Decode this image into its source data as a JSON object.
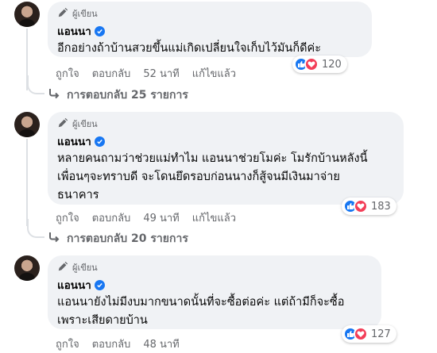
{
  "comments": [
    {
      "badge": "ผู้เขียน",
      "author": "แอนนา",
      "text": "อีกอย่างถ้าบ้านสวยขึ้นแม่เกิดเปลี่ยนใจเก็บไว้มันก็ดีค่ะ",
      "reaction_count": "120",
      "actions": {
        "like": "ถูกใจ",
        "reply": "ตอบกลับ",
        "time": "52 นาที",
        "edited": "แก้ไขแล้ว"
      },
      "replies": "การตอบกลับ 25 รายการ"
    },
    {
      "badge": "ผู้เขียน",
      "author": "แอนนา",
      "text": "หลายคนถามว่าช่วยแม่ทำไม แอนนาช่วยโมค่ะ โมรักบ้านหลังนี้\nเพื่อนๆจะทราบดี จะโดนยึดรอบก่อนนางก็สู้จนมีเงินมาจ่าย\nธนาคาร",
      "reaction_count": "183",
      "actions": {
        "like": "ถูกใจ",
        "reply": "ตอบกลับ",
        "time": "49 นาที",
        "edited": "แก้ไขแล้ว"
      },
      "replies": "การตอบกลับ 20 รายการ"
    },
    {
      "badge": "ผู้เขียน",
      "author": "แอนนา",
      "text": "แอนนายังไม่มีงบมากขนาดนั้นที่จะซื้อต่อค่ะ แต่ถ้ามีก็จะซื้อ\nเพราะเสียดายบ้าน",
      "reaction_count": "127",
      "actions": {
        "like": "ถูกใจ",
        "reply": "ตอบกลับ",
        "time": "48 นาที"
      }
    }
  ],
  "colors": {
    "like_blue": "#1877f2",
    "love_red": "#f33e58",
    "bubble_bg": "#f0f2f5",
    "meta_gray": "#65676b"
  },
  "icons": {
    "badge": "pencil-icon",
    "verified": "verified-check-icon",
    "replies": "reply-arrow-icon"
  }
}
